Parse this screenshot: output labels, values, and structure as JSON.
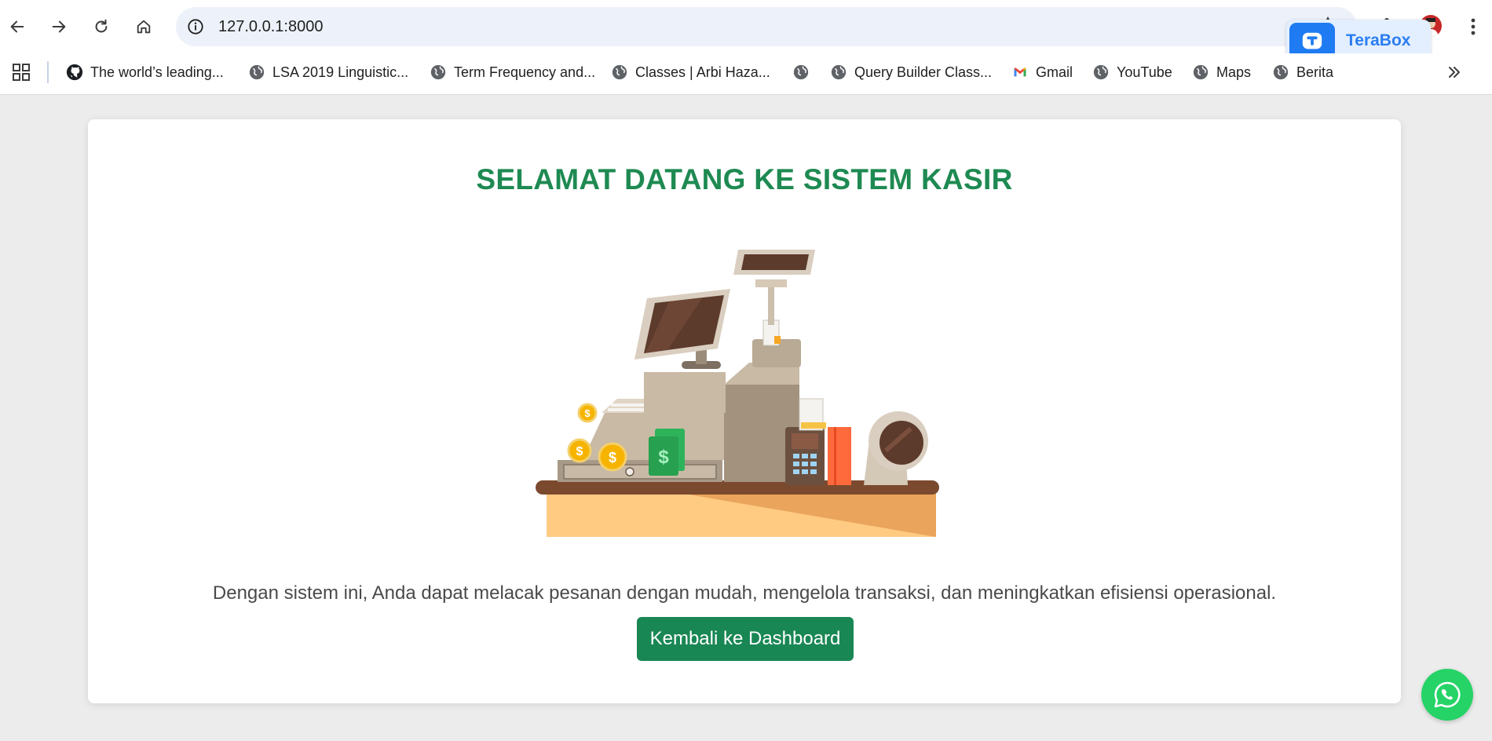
{
  "browser": {
    "url": "127.0.0.1:8000",
    "extension_label": "TeraBox",
    "bookmarks": [
      {
        "label": "The world’s leading...",
        "icon": "github-icon"
      },
      {
        "label": "LSA 2019 Linguistic...",
        "icon": "globe-icon"
      },
      {
        "label": "Term Frequency and...",
        "icon": "globe-icon"
      },
      {
        "label": "Classes | Arbi Haza...",
        "icon": "globe-icon"
      },
      {
        "label": "",
        "icon": "globe-icon"
      },
      {
        "label": "Query Builder Class...",
        "icon": "globe-icon"
      },
      {
        "label": "Gmail",
        "icon": "gmail-icon"
      },
      {
        "label": "YouTube",
        "icon": "globe-icon"
      },
      {
        "label": "Maps",
        "icon": "globe-icon"
      },
      {
        "label": "Berita",
        "icon": "globe-icon"
      }
    ]
  },
  "page": {
    "title": "SELAMAT DATANG KE SISTEM KASIR",
    "description": "Dengan sistem ini, Anda dapat melacak pesanan dengan mudah, mengelola transaksi, dan meningkatkan efisiensi operasional.",
    "button_label": "Kembali ke Dashboard",
    "illustration": "cash-register-illustration"
  },
  "colors": {
    "accent": "#1e8a52",
    "button": "#198754",
    "whatsapp": "#25d366",
    "terabox": "#1f7bf2"
  }
}
